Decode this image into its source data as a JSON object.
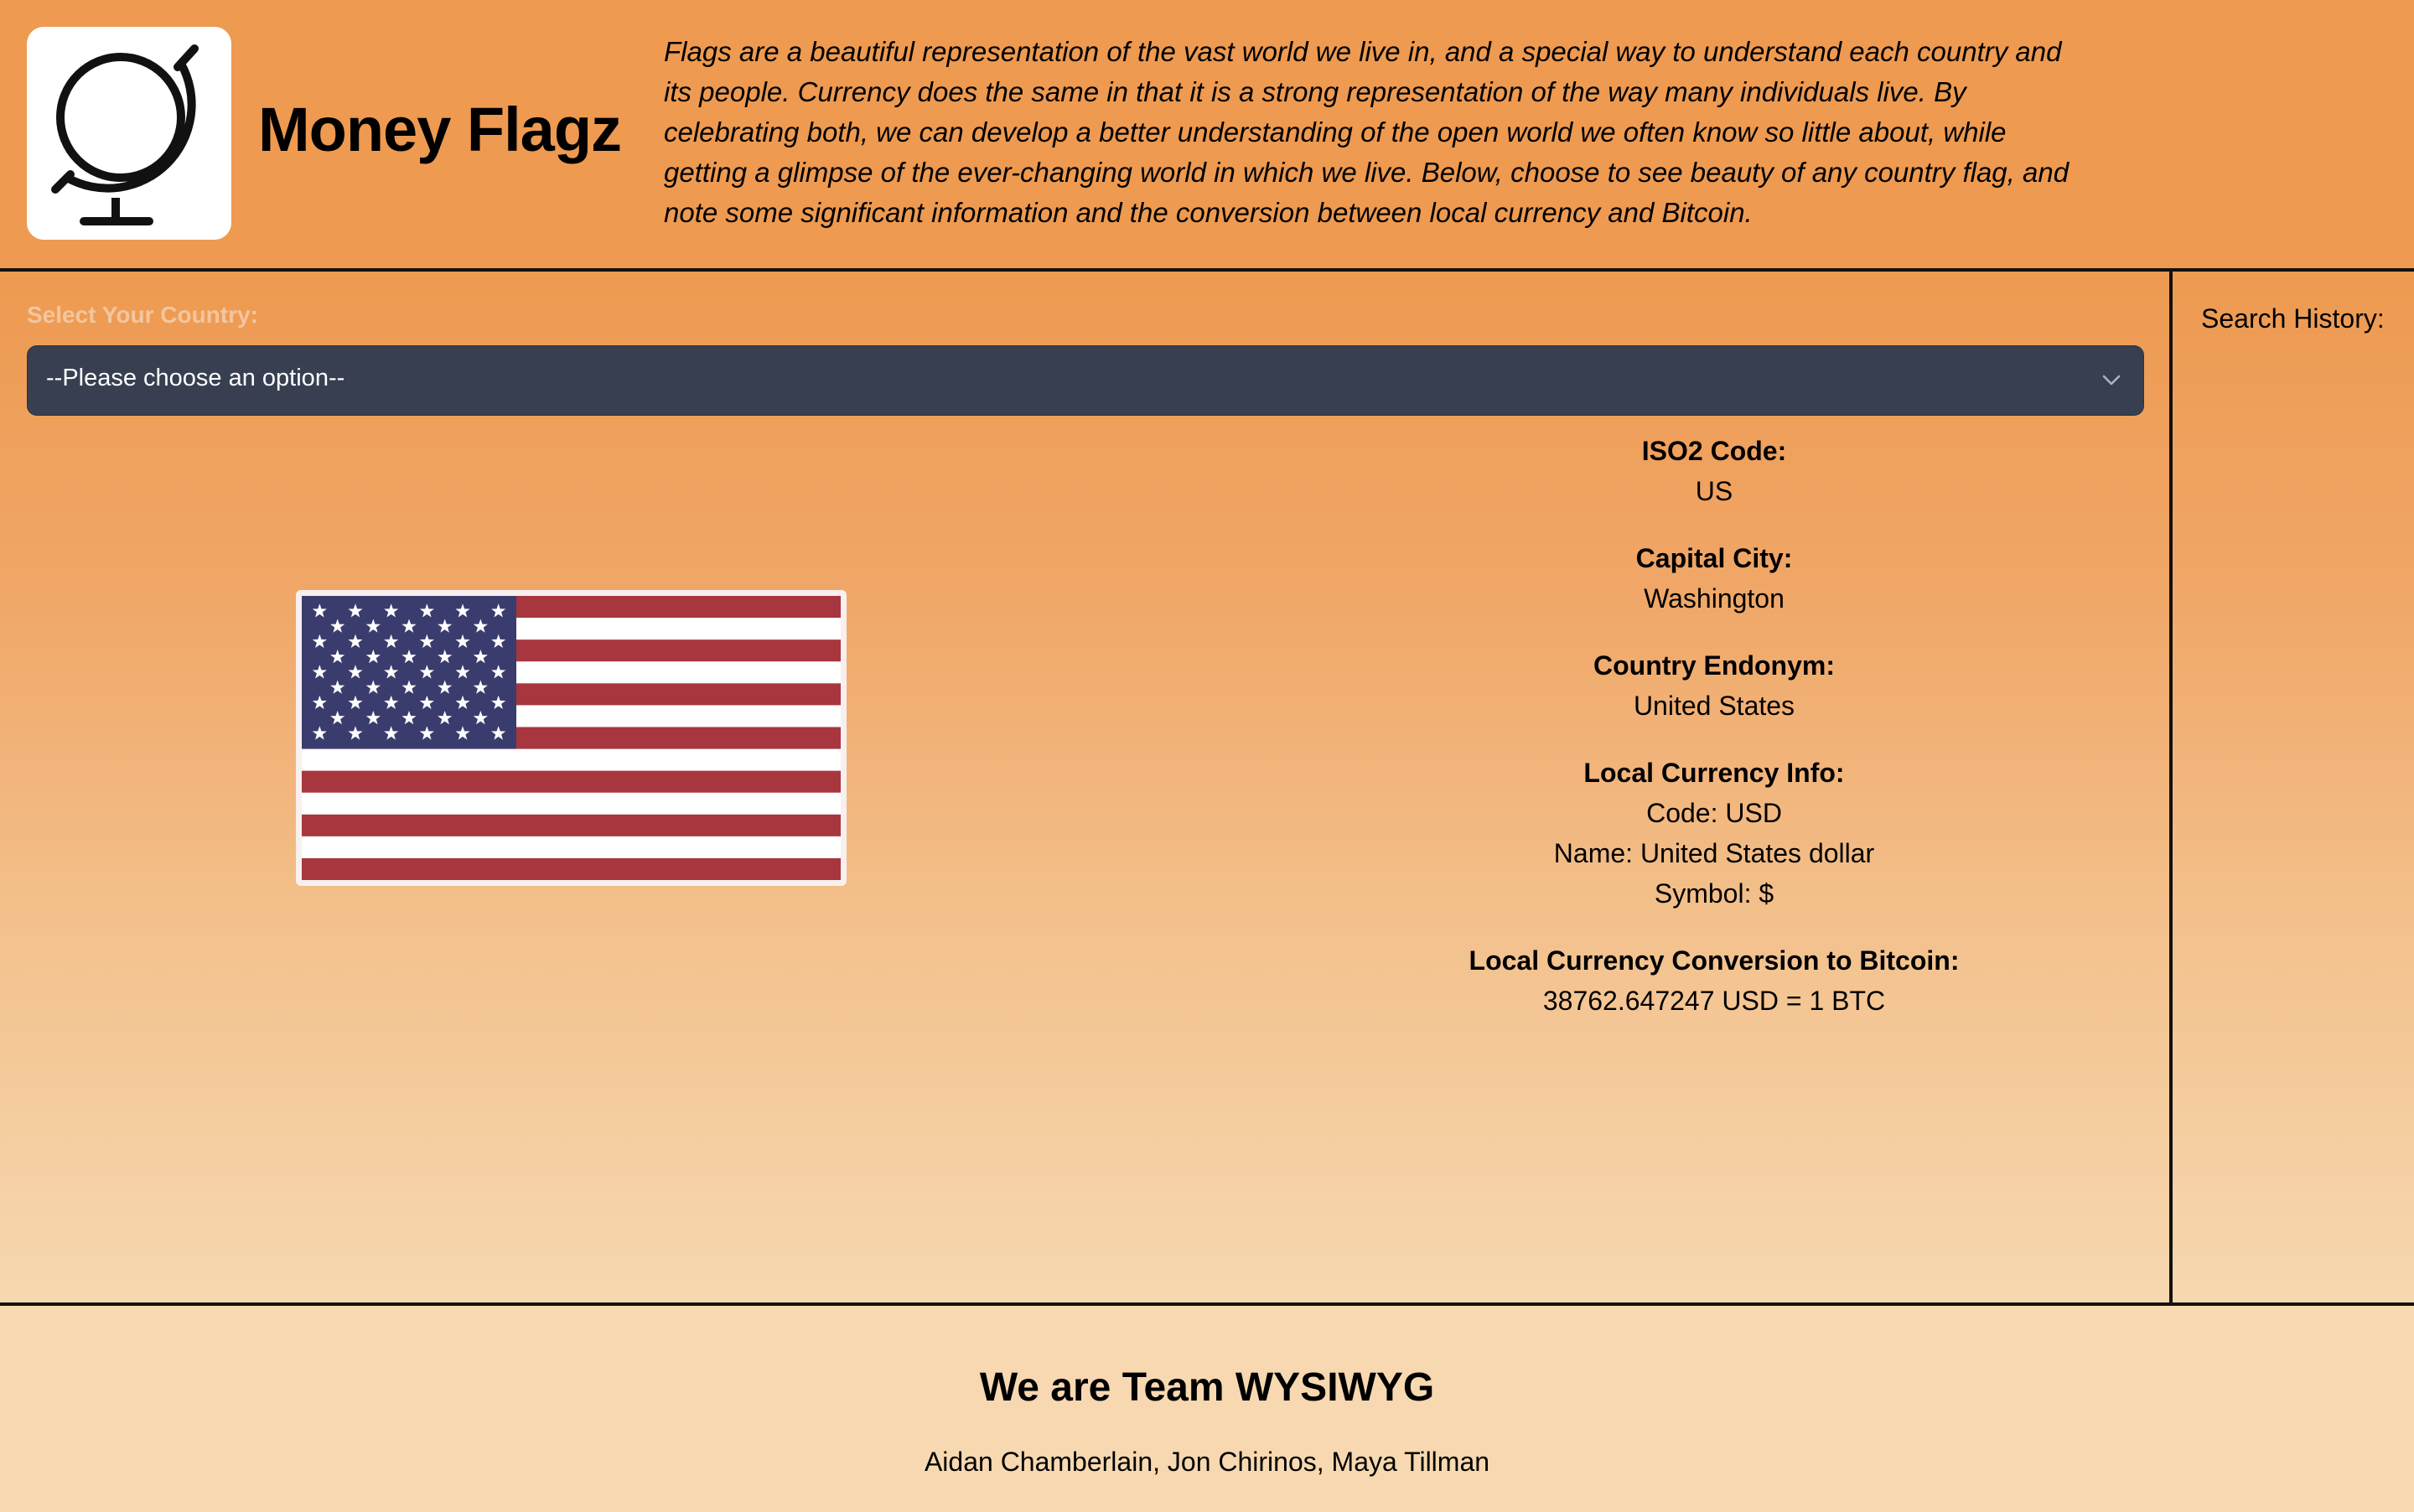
{
  "header": {
    "logo_icon": "globe-icon",
    "title": "Money Flagz",
    "intro": "Flags are a beautiful representation of the vast world we live in, and a special way to understand each country and its people. Currency does the same in that it is a strong representation of the way many individuals live. By celebrating both, we can develop a better understanding of the open world we often know so little about, while getting a glimpse of the ever-changing world in which we live. Below, choose to see beauty of any country flag, and note some significant information and the conversion between local currency and Bitcoin."
  },
  "selector": {
    "label": "Select Your Country:",
    "value": "--Please choose an option--",
    "icon": "chevron-down-icon"
  },
  "flag": {
    "icon": "us-flag",
    "colors": {
      "red": "#a8363f",
      "white": "#ffffff",
      "blue": "#3b3c6e"
    }
  },
  "info": {
    "iso_label": "ISO2 Code:",
    "iso_value": "US",
    "capital_label": "Capital City:",
    "capital_value": "Washington",
    "endonym_label": "Country Endonym:",
    "endonym_value": "United States",
    "currency_label": "Local Currency Info:",
    "currency_code": "Code: USD",
    "currency_name": "Name: United States dollar",
    "currency_symbol": "Symbol: $",
    "conversion_label": "Local Currency Conversion to Bitcoin:",
    "conversion_value": "38762.647247 USD = 1 BTC"
  },
  "sidebar": {
    "history_label": "Search History:"
  },
  "footer": {
    "team_title": "We are Team WYSIWYG",
    "members": "Aidan Chamberlain, Jon Chirinos, Maya Tillman"
  },
  "colors": {
    "header_bg": "#ee9a50",
    "select_bg": "#383f51",
    "footer_bg": "#f7d8b0"
  }
}
